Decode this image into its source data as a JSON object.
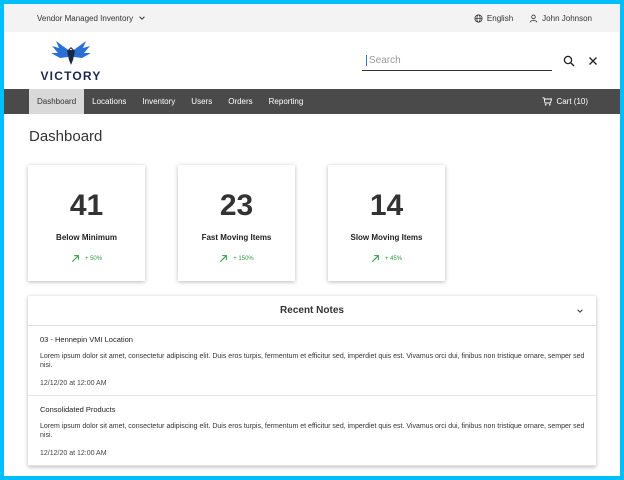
{
  "utility": {
    "app_switcher": "Vendor Managed Inventory",
    "language": "English",
    "user": "John Johnson"
  },
  "logo": {
    "text": "VICTORY",
    "icon": "eagle-logo-icon"
  },
  "search": {
    "placeholder": "Search",
    "value": ""
  },
  "nav": {
    "items": [
      "Dashboard",
      "Locations",
      "Inventory",
      "Users",
      "Orders",
      "Reporting"
    ],
    "active": "Dashboard",
    "cart": "Cart (10)"
  },
  "page_title": "Dashboard",
  "cards": [
    {
      "number": "41",
      "label": "Below Minimum",
      "trend": "+ 50%"
    },
    {
      "number": "23",
      "label": "Fast Moving Items",
      "trend": "+ 150%"
    },
    {
      "number": "14",
      "label": "Slow Moving Items",
      "trend": "+ 45%"
    }
  ],
  "notes": {
    "title": "Recent Notes",
    "items": [
      {
        "title": "03 - Hennepin VMI Location",
        "body": "Lorem ipsum dolor sit amet, consectetur adipiscing elit. Duis eros turpis, fermentum et efficitur sed, imperdiet quis est. Vivamus orci dui, finibus non tristique ornare, semper sed nisi.",
        "date": "12/12/20 at 12:00 AM"
      },
      {
        "title": "Consolidated Products",
        "body": "Lorem ipsum dolor sit amet, consectetur adipiscing elit. Duis eros turpis, fermentum et efficitur sed, imperdiet quis est. Vivamus orci dui, finibus non tristique ornare, semper sed nisi.",
        "date": "12/12/20 at 12:00 AM"
      }
    ]
  },
  "colors": {
    "frame": "#00bfff",
    "nav_bg": "#4a4a4a",
    "nav_active_bg": "#d9d9d9",
    "trend_green": "#2e9b3e",
    "logo_blue": "#2a6fd6"
  }
}
